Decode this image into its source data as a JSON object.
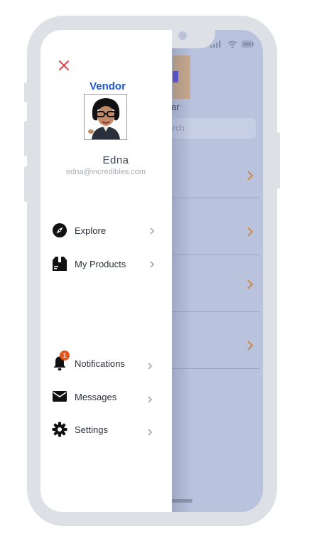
{
  "background_app": {
    "name_fragment": "ar",
    "search_placeholder_fragment": "rch",
    "accent_color": "#c88a4a"
  },
  "drawer": {
    "close_icon": "close-icon",
    "role_title": "Vendor",
    "user": {
      "name": "Edna",
      "email": "edna@incredibles.com"
    },
    "nav_items": [
      {
        "label": "Explore",
        "icon": "compass-icon"
      },
      {
        "label": "My Products",
        "icon": "box-icon"
      }
    ],
    "bottom_items": [
      {
        "label": "Notifications",
        "icon": "bell-icon",
        "badge": "1"
      },
      {
        "label": "Messages",
        "icon": "envelope-icon"
      },
      {
        "label": "Settings",
        "icon": "gear-icon"
      }
    ]
  },
  "colors": {
    "role_title": "#1f56c8",
    "close": "#e0454a",
    "badge": "#e5531d",
    "frame": "#dde1e6",
    "screen_overlay": "#b9c3dd"
  }
}
